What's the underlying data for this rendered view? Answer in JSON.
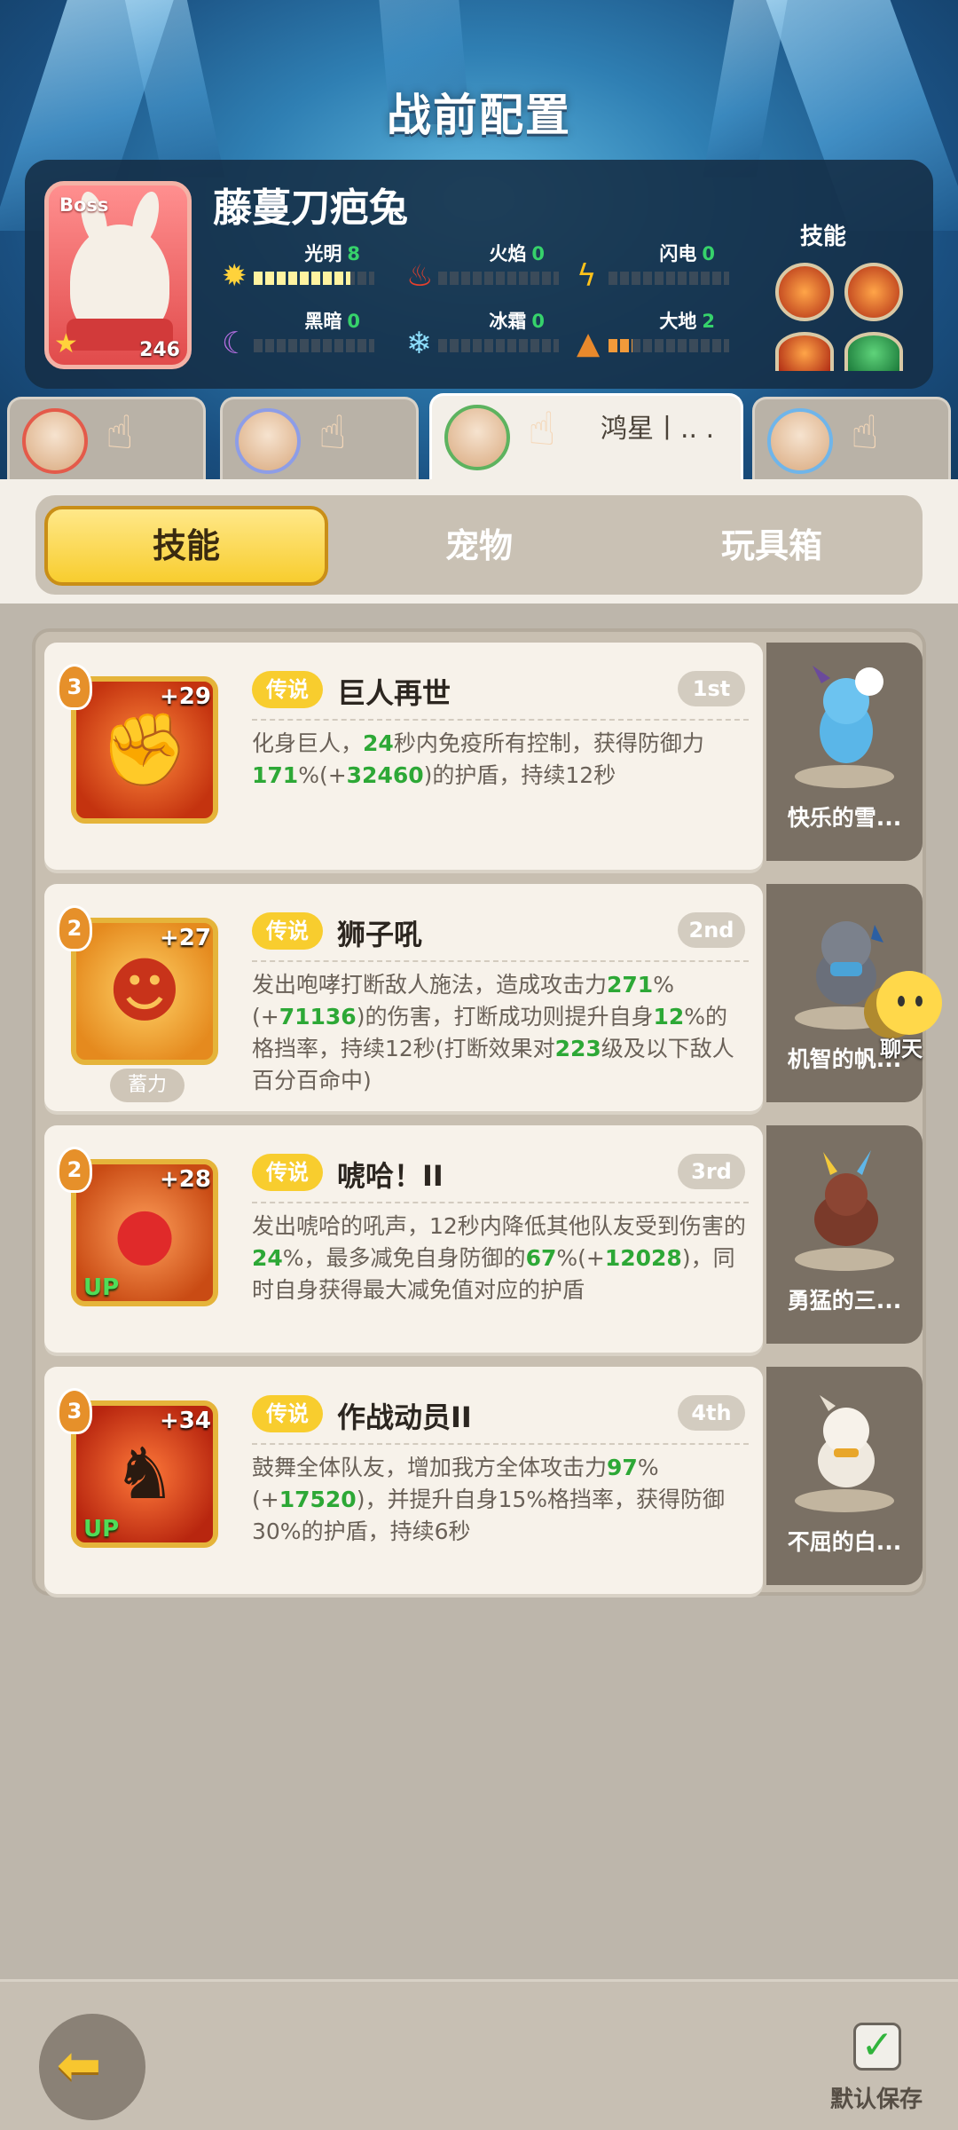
{
  "page_title": "战前配置",
  "boss": {
    "tag": "Boss",
    "name": "藤蔓刀疤兔",
    "level": "246",
    "elements": [
      {
        "label": "光明",
        "value": "8",
        "icon": "sun-icon",
        "fill": 0.8
      },
      {
        "label": "火焰",
        "value": "0",
        "icon": "flame-icon",
        "fill": 0
      },
      {
        "label": "闪电",
        "value": "0",
        "icon": "lightning-icon",
        "fill": 0
      },
      {
        "label": "黑暗",
        "value": "0",
        "icon": "moon-icon",
        "fill": 0
      },
      {
        "label": "冰霜",
        "value": "0",
        "icon": "snowflake-icon",
        "fill": 0
      },
      {
        "label": "大地",
        "value": "2",
        "icon": "mountain-icon",
        "fill": 0.2
      }
    ],
    "skills_label": "技能"
  },
  "heroes": [
    {
      "name": ""
    },
    {
      "name": ""
    },
    {
      "name": "鸿星丨.. ."
    },
    {
      "name": ""
    }
  ],
  "tabs": [
    {
      "label": "技能",
      "active": true
    },
    {
      "label": "宠物",
      "active": false
    },
    {
      "label": "玩具箱",
      "active": false
    }
  ],
  "skills": [
    {
      "level": "3",
      "bonus": "+29",
      "badge": "",
      "rarity": "传说",
      "name": "巨人再世",
      "rank": "1st",
      "desc": [
        {
          "t": "化身巨人，"
        },
        {
          "t": "24",
          "g": true
        },
        {
          "t": "秒内免疫所有控制，获得防御力"
        },
        {
          "t": "171",
          "g": true
        },
        {
          "t": "%(+"
        },
        {
          "t": "32460",
          "g": true
        },
        {
          "t": ")的护盾，持续12秒"
        }
      ],
      "pet_name": "快乐的雪..."
    },
    {
      "level": "2",
      "bonus": "+27",
      "badge": "",
      "charge": "蓄力",
      "rarity": "传说",
      "name": "狮子吼",
      "rank": "2nd",
      "desc": [
        {
          "t": "发出咆哮打断敌人施法，造成攻击力"
        },
        {
          "t": "271",
          "g": true
        },
        {
          "t": "%(+"
        },
        {
          "t": "71136",
          "g": true
        },
        {
          "t": ")的伤害，打断成功则提升自身"
        },
        {
          "t": "12",
          "g": true
        },
        {
          "t": "%的格挡率，持续12秒(打断效果对"
        },
        {
          "t": "223",
          "g": true
        },
        {
          "t": "级及以下敌人百分百命中)"
        }
      ],
      "pet_name": "机智的帆..."
    },
    {
      "level": "2",
      "bonus": "+28",
      "badge": "UP",
      "rarity": "传说",
      "name": "唬哈！II",
      "rank": "3rd",
      "desc": [
        {
          "t": "发出唬哈的吼声，12秒内降低其他队友受到伤害的"
        },
        {
          "t": "24",
          "g": true
        },
        {
          "t": "%，最多减免自身防御的"
        },
        {
          "t": "67",
          "g": true
        },
        {
          "t": "%(+"
        },
        {
          "t": "12028",
          "g": true
        },
        {
          "t": ")，同时自身获得最大减免值对应的护盾"
        }
      ],
      "pet_name": "勇猛的三..."
    },
    {
      "level": "3",
      "bonus": "+34",
      "badge": "UP",
      "rarity": "传说",
      "name": "作战动员II",
      "rank": "4th",
      "desc": [
        {
          "t": "鼓舞全体队友，增加我方全体攻击力"
        },
        {
          "t": "97",
          "g": true
        },
        {
          "t": "%(+"
        },
        {
          "t": "17520",
          "g": true
        },
        {
          "t": ")，并提升自身15%格挡率，获得防御30%的护盾，持续6秒"
        }
      ],
      "pet_name": "不屈的白..."
    }
  ],
  "chat_label": "聊天",
  "bottom": {
    "save_label": "默认保存"
  },
  "colors": {
    "accent_yellow": "#f8cd2e",
    "value_green": "#2da836",
    "panel_dark": "#142d46"
  }
}
